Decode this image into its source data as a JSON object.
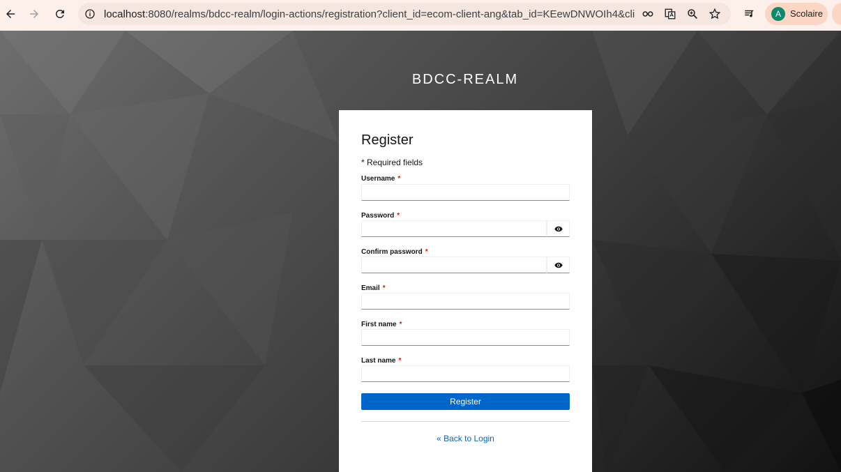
{
  "browser": {
    "url_host": "localhost",
    "url_rest": ":8080/realms/bdcc-realm/login-actions/registration?client_id=ecom-client-ang&tab_id=KEewDNWOIh4&client_...",
    "profile_initial": "A",
    "profile_name": "Scolaire",
    "icons": [
      "back-arrow-icon",
      "forward-arrow-icon",
      "reload-icon",
      "site-info-icon",
      "password-key-icon",
      "translate-icon",
      "zoom-icon",
      "bookmark-star-icon",
      "media-queue-icon"
    ]
  },
  "page": {
    "realm": "BDCC-REALM",
    "title": "Register",
    "required_note": "* Required fields",
    "fields": [
      {
        "label": "Username",
        "required": "*",
        "value": ""
      },
      {
        "label": "Password",
        "required": "*",
        "value": ""
      },
      {
        "label": "Confirm password",
        "required": "*",
        "value": ""
      },
      {
        "label": "Email",
        "required": "*",
        "value": ""
      },
      {
        "label": "First name",
        "required": "*",
        "value": ""
      },
      {
        "label": "Last name",
        "required": "*",
        "value": ""
      }
    ],
    "register_label": "Register",
    "back_link": "« Back to Login"
  },
  "colors": {
    "accent": "#0066cc",
    "required": "#c9190b",
    "toolbar": "#fdf0ea",
    "avatar": "#0b8a6e"
  }
}
